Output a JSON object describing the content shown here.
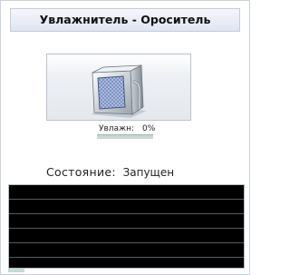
{
  "window": {
    "title": "Увлажнитель - Ороситель"
  },
  "device": {
    "icon": "humidifier-icon"
  },
  "humidity": {
    "label": "Увлажн:",
    "value_text": "0%",
    "level_percent": 0
  },
  "status": {
    "label": "Состояние:",
    "value": "Запущен"
  },
  "log": {
    "rows": [
      "",
      "",
      "",
      "",
      "",
      ""
    ]
  },
  "colors": {
    "log_background": "#000000",
    "gauge_fill": "#3e9a84",
    "title_bar": "#dfe5f1"
  }
}
